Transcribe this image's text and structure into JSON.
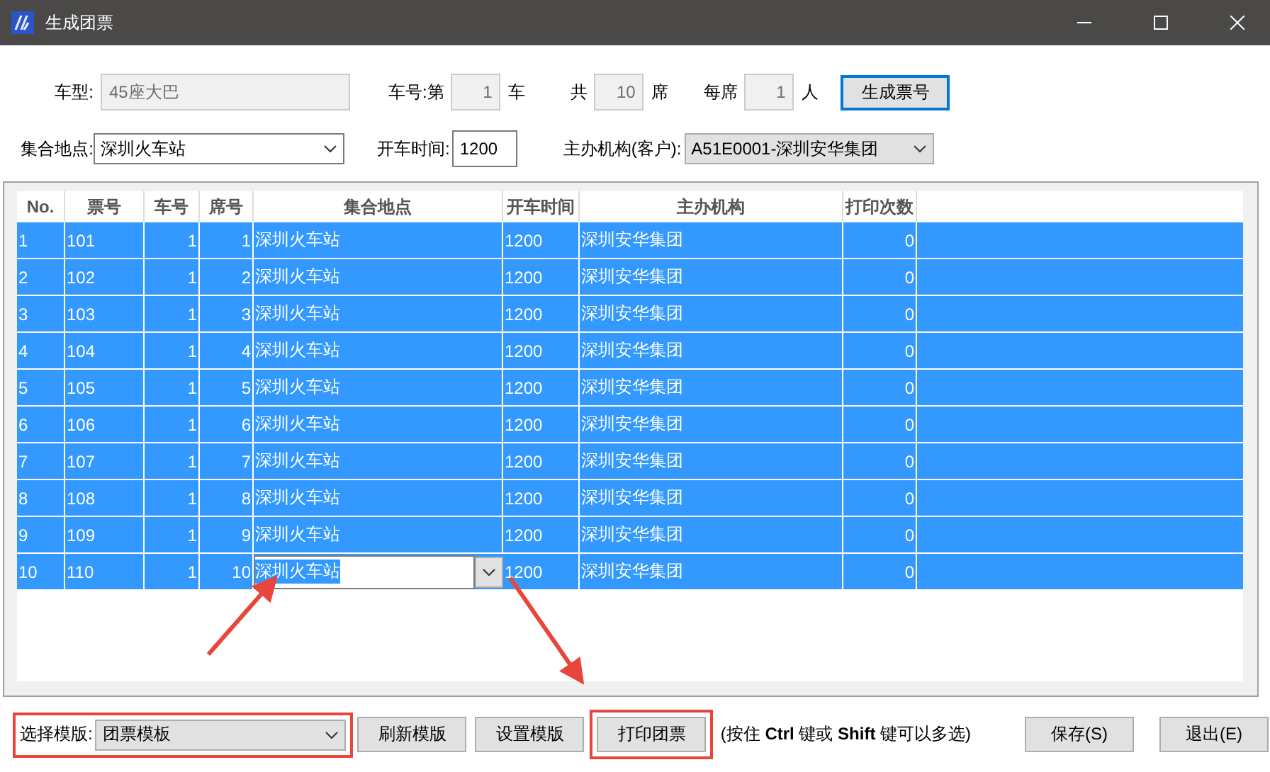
{
  "window": {
    "title": "生成团票"
  },
  "form": {
    "bus_type": {
      "label": "车型:",
      "value": "45座大巴",
      "disabled": true
    },
    "bus_no": {
      "label": "车号:第",
      "value": "1",
      "unit": "车",
      "disabled": true
    },
    "total": {
      "label": "共",
      "value": "10",
      "unit": "席",
      "disabled": true
    },
    "per_seat": {
      "label": "每席",
      "value": "1",
      "unit": "人",
      "disabled": true
    },
    "generate_button": "生成票号",
    "meeting_place": {
      "label": "集合地点:",
      "value": "深圳火车站"
    },
    "departure_time": {
      "label": "开车时间:",
      "value": "1200"
    },
    "organizer": {
      "label": "主办机构(客户):",
      "value": "A51E0001-深圳安华集团"
    }
  },
  "table": {
    "columns": [
      "No.",
      "票号",
      "车号",
      "席号",
      "集合地点",
      "开车时间",
      "主办机构",
      "打印次数"
    ],
    "rows": [
      {
        "cells": [
          "1",
          "101",
          "1",
          "1",
          "深圳火车站",
          "1200",
          "深圳安华集团",
          "0"
        ],
        "selected": true,
        "editing": false
      },
      {
        "cells": [
          "2",
          "102",
          "1",
          "2",
          "深圳火车站",
          "1200",
          "深圳安华集团",
          "0"
        ],
        "selected": true,
        "editing": false
      },
      {
        "cells": [
          "3",
          "103",
          "1",
          "3",
          "深圳火车站",
          "1200",
          "深圳安华集团",
          "0"
        ],
        "selected": true,
        "editing": false
      },
      {
        "cells": [
          "4",
          "104",
          "1",
          "4",
          "深圳火车站",
          "1200",
          "深圳安华集团",
          "0"
        ],
        "selected": true,
        "editing": false
      },
      {
        "cells": [
          "5",
          "105",
          "1",
          "5",
          "深圳火车站",
          "1200",
          "深圳安华集团",
          "0"
        ],
        "selected": true,
        "editing": false
      },
      {
        "cells": [
          "6",
          "106",
          "1",
          "6",
          "深圳火车站",
          "1200",
          "深圳安华集团",
          "0"
        ],
        "selected": true,
        "editing": false
      },
      {
        "cells": [
          "7",
          "107",
          "1",
          "7",
          "深圳火车站",
          "1200",
          "深圳安华集团",
          "0"
        ],
        "selected": true,
        "editing": false
      },
      {
        "cells": [
          "8",
          "108",
          "1",
          "8",
          "深圳火车站",
          "1200",
          "深圳安华集团",
          "0"
        ],
        "selected": true,
        "editing": false
      },
      {
        "cells": [
          "9",
          "109",
          "1",
          "9",
          "深圳火车站",
          "1200",
          "深圳安华集团",
          "0"
        ],
        "selected": true,
        "editing": false
      },
      {
        "cells": [
          "10",
          "110",
          "1",
          "10",
          "深圳火车站",
          "1200",
          "深圳安华集团",
          "0"
        ],
        "selected": true,
        "editing": true
      }
    ]
  },
  "footer": {
    "template": {
      "label": "选择模版:",
      "value": "团票模板"
    },
    "buttons": [
      "刷新模版",
      "设置模版",
      "打印团票"
    ],
    "hint": "(按住 **Ctrl** 键或 **Shift** 键可以多选)",
    "save_button": "保存(S)",
    "exit_button": "退出(E)"
  }
}
